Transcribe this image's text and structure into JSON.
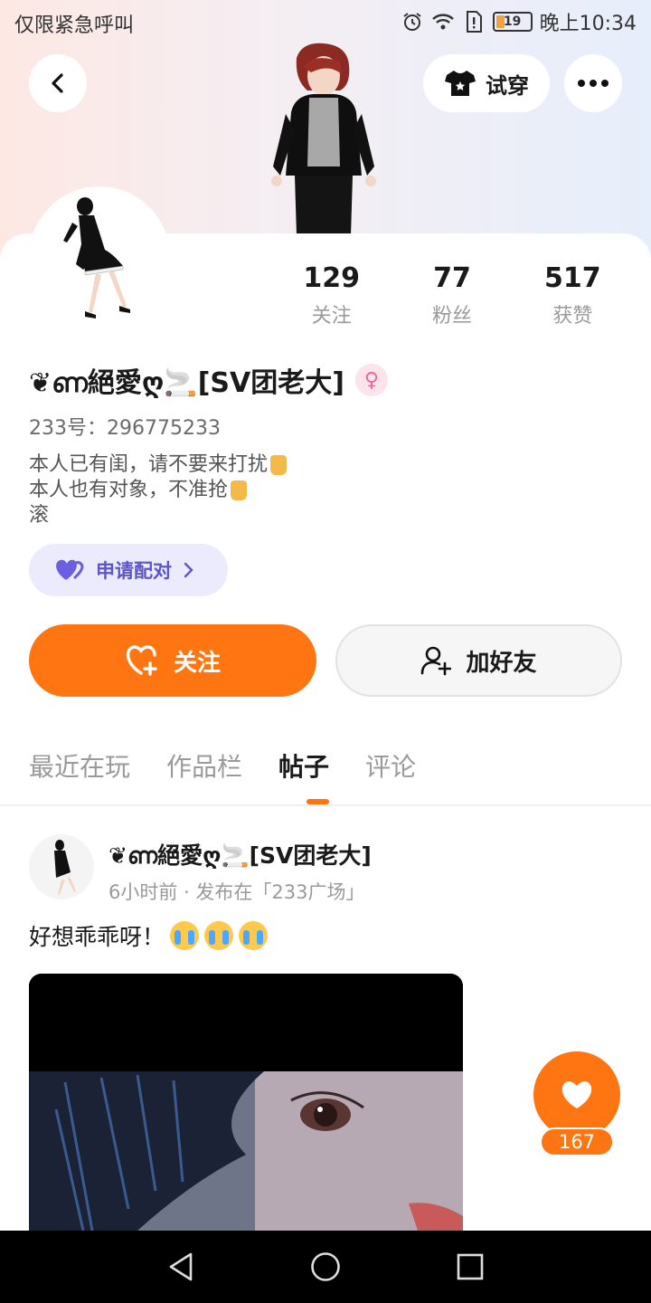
{
  "status_bar": {
    "carrier_text": "仅限紧急呼叫",
    "battery_level": "19",
    "time": "晚上10:34",
    "icons": [
      "alarm-icon",
      "wifi-icon",
      "sim-alert-icon",
      "battery-icon"
    ]
  },
  "header": {
    "tryon_label": "试穿",
    "icons": [
      "back-icon",
      "shirt-icon",
      "more-icon"
    ]
  },
  "stats": [
    {
      "value": "129",
      "label": "关注"
    },
    {
      "value": "77",
      "label": "粉丝"
    },
    {
      "value": "517",
      "label": "获赞"
    }
  ],
  "profile": {
    "nickname": "❦ണ絕愛ღ🚬[SV团老大]",
    "gender_icon": "female-icon",
    "user_id": "233号：296775233",
    "bio_lines": [
      "本人已有闺，请不要来打扰",
      "本人也有对象，不准抢",
      "滚"
    ],
    "pair_label": "申请配对"
  },
  "actions": {
    "follow_label": "关注",
    "add_friend_label": "加好友"
  },
  "tabs": [
    {
      "label": "最近在玩",
      "active": false
    },
    {
      "label": "作品栏",
      "active": false
    },
    {
      "label": "帖子",
      "active": true
    },
    {
      "label": "评论",
      "active": false
    }
  ],
  "post": {
    "author": "❦ണ絕愛ღ🚬[SV团老大]",
    "meta": "6小时前 · 发布在「233广场」",
    "text": "好想乖乖呀！",
    "like_count": "167"
  },
  "colors": {
    "accent": "#ff7511",
    "pair_bg": "#eceafd",
    "pair_text": "#5b55c9"
  }
}
